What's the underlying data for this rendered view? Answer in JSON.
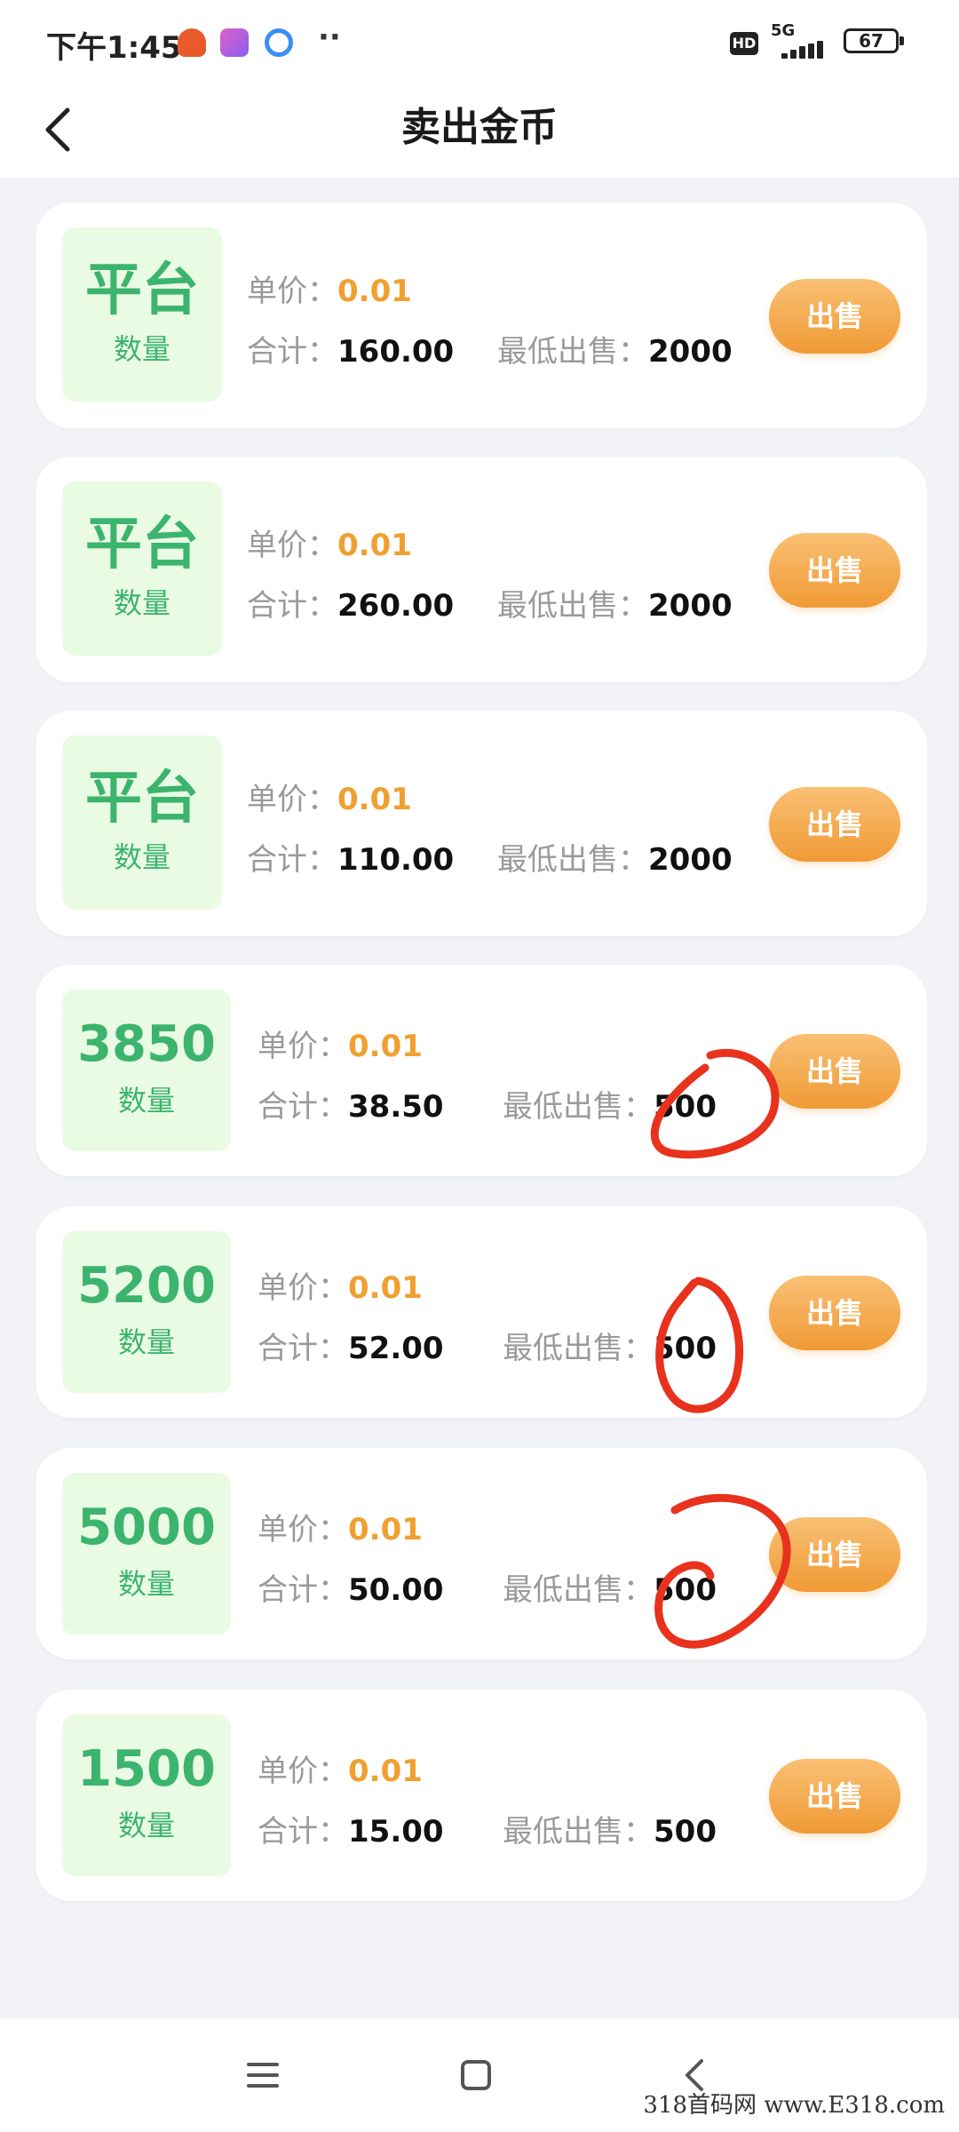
{
  "status_bar": {
    "time": "下午1:45",
    "dots": "··",
    "hd": "HD",
    "network": "5G",
    "battery": "67"
  },
  "header": {
    "title": "卖出金币",
    "back_icon": "chevron-left-icon"
  },
  "labels": {
    "unit_price": "单价：",
    "total": "合计：",
    "min_sell": "最低出售：",
    "quantity": "数量",
    "sell": "出售"
  },
  "listings": [
    {
      "quantity": "平台",
      "unit_price": "0.01",
      "total": "160.00",
      "min_sell": "2000"
    },
    {
      "quantity": "平台",
      "unit_price": "0.01",
      "total": "260.00",
      "min_sell": "2000"
    },
    {
      "quantity": "平台",
      "unit_price": "0.01",
      "total": "110.00",
      "min_sell": "2000"
    },
    {
      "quantity": "3850",
      "unit_price": "0.01",
      "total": "38.50",
      "min_sell": "500"
    },
    {
      "quantity": "5200",
      "unit_price": "0.01",
      "total": "52.00",
      "min_sell": "500"
    },
    {
      "quantity": "5000",
      "unit_price": "0.01",
      "total": "50.00",
      "min_sell": "500"
    },
    {
      "quantity": "1500",
      "unit_price": "0.01",
      "total": "15.00",
      "min_sell": "500"
    }
  ],
  "colors": {
    "accent_green": "#3cb46e",
    "price_orange": "#f0a030",
    "button_orange": "#f09a35",
    "annotation_red": "#e8321e"
  },
  "nav": {
    "menu_icon": "menu-icon",
    "home_icon": "square-home-icon",
    "back_icon": "triangle-back-icon"
  },
  "watermark": "318首码网 www.E318.com"
}
